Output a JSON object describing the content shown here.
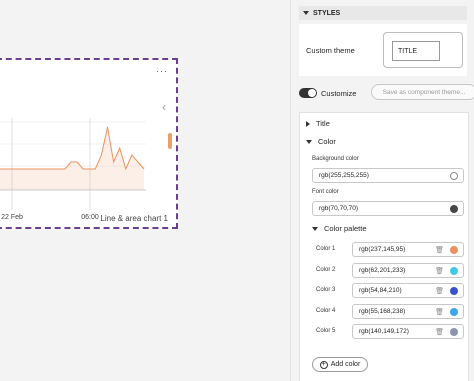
{
  "canvas": {
    "more_icon": "···",
    "chevron": "‹",
    "chart_caption": "Line & area chart 1"
  },
  "chart_data": {
    "type": "line",
    "x_tick_labels": [
      "22 Feb",
      "06:00"
    ],
    "series": [
      {
        "values": [
          3,
          3,
          3,
          3,
          3,
          3,
          3,
          3,
          3,
          3,
          3,
          3,
          4,
          4,
          3,
          3,
          3,
          5,
          9,
          4,
          6,
          3,
          5,
          4,
          3
        ]
      }
    ]
  },
  "pane": {
    "section_title": "STYLES",
    "custom_theme_label": "Custom theme",
    "theme_preview_text": "TITLE",
    "customize_label": "Customize",
    "save_theme_label": "Save as component theme...",
    "title_section": "Title",
    "color_section": "Color",
    "background_label": "Background color",
    "background_value": "rgb(255,255,255)",
    "background_hex": "#ffffff",
    "font_label": "Font color",
    "font_value": "rgb(70,70,70)",
    "font_hex": "#464646",
    "palette_section": "Color palette",
    "palette": [
      {
        "label": "Color 1",
        "value": "rgb(237,145,95)",
        "hex": "#ed915f"
      },
      {
        "label": "Color 2",
        "value": "rgb(62,201,233)",
        "hex": "#3ec9e9"
      },
      {
        "label": "Color 3",
        "value": "rgb(54,84,210)",
        "hex": "#3654d2"
      },
      {
        "label": "Color 4",
        "value": "rgb(55,168,238)",
        "hex": "#37a8ee"
      },
      {
        "label": "Color 5",
        "value": "rgb(140,149,172)",
        "hex": "#8c95ac"
      }
    ],
    "add_color_label": "Add color"
  },
  "colors": {
    "selection_border": "#6b3f8f",
    "series_line": "#ed915f"
  }
}
